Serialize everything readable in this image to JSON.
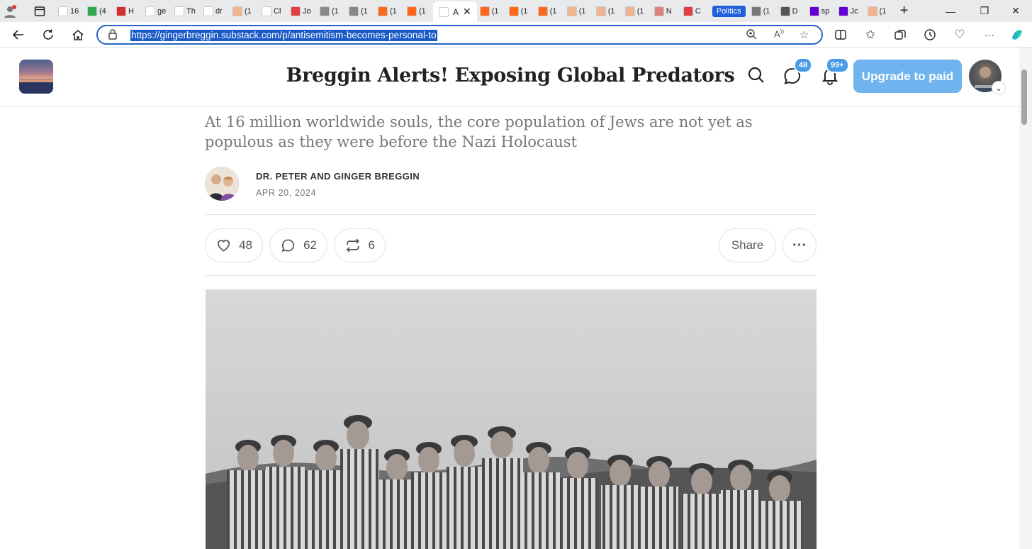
{
  "browser": {
    "tabs": [
      {
        "label": "16",
        "color": "#ffffff"
      },
      {
        "label": "(4",
        "color": "#2fa84f"
      },
      {
        "label": "H",
        "color": "#d32f2f"
      },
      {
        "label": "ge",
        "color": "#ffffff"
      },
      {
        "label": "Th",
        "color": "#ffffff"
      },
      {
        "label": "dr",
        "color": "#ffffff"
      },
      {
        "label": "(1",
        "color": "#f2b38f"
      },
      {
        "label": "Cl",
        "color": "#ffffff"
      },
      {
        "label": "Jo",
        "color": "#e04040"
      },
      {
        "label": "(1",
        "color": "#888888"
      },
      {
        "label": "(1",
        "color": "#888888"
      },
      {
        "label": "(1",
        "color": "#ff6719"
      },
      {
        "label": "(1",
        "color": "#ff6719"
      }
    ],
    "active_tab": {
      "label": "A"
    },
    "tabs_right": [
      {
        "label": "(1",
        "color": "#ff6719"
      },
      {
        "label": "(1",
        "color": "#ff6719"
      },
      {
        "label": "(1",
        "color": "#ff6719"
      },
      {
        "label": "(1",
        "color": "#f2b38f"
      },
      {
        "label": "(1",
        "color": "#f2b38f"
      },
      {
        "label": "(1",
        "color": "#f2b38f"
      },
      {
        "label": "N",
        "color": "#e08080"
      },
      {
        "label": "C",
        "color": "#e04040"
      }
    ],
    "politics_pill": "Politics",
    "tabs_far": [
      {
        "label": "(1",
        "color": "#777777"
      },
      {
        "label": "D",
        "color": "#555555"
      },
      {
        "label": "sp",
        "color": "#6001d2"
      },
      {
        "label": "Jc",
        "color": "#6001d2"
      },
      {
        "label": "(1",
        "color": "#f2b38f"
      }
    ],
    "url": "https://gingerbreggin.substack.com/p/antisemitism-becomes-personal-to"
  },
  "header": {
    "title": "Breggin Alerts! Exposing Global Predators",
    "chat_badge": "48",
    "notif_badge": "99+",
    "upgrade_label": "Upgrade to paid"
  },
  "article": {
    "subtitle": "At 16 million worldwide souls, the core population of Jews are not yet as populous as they were before the Nazi Holocaust",
    "author": "DR. PETER AND GINGER BREGGIN",
    "date": "APR 20, 2024",
    "likes": "48",
    "comments": "62",
    "restacks": "6",
    "share_label": "Share"
  }
}
